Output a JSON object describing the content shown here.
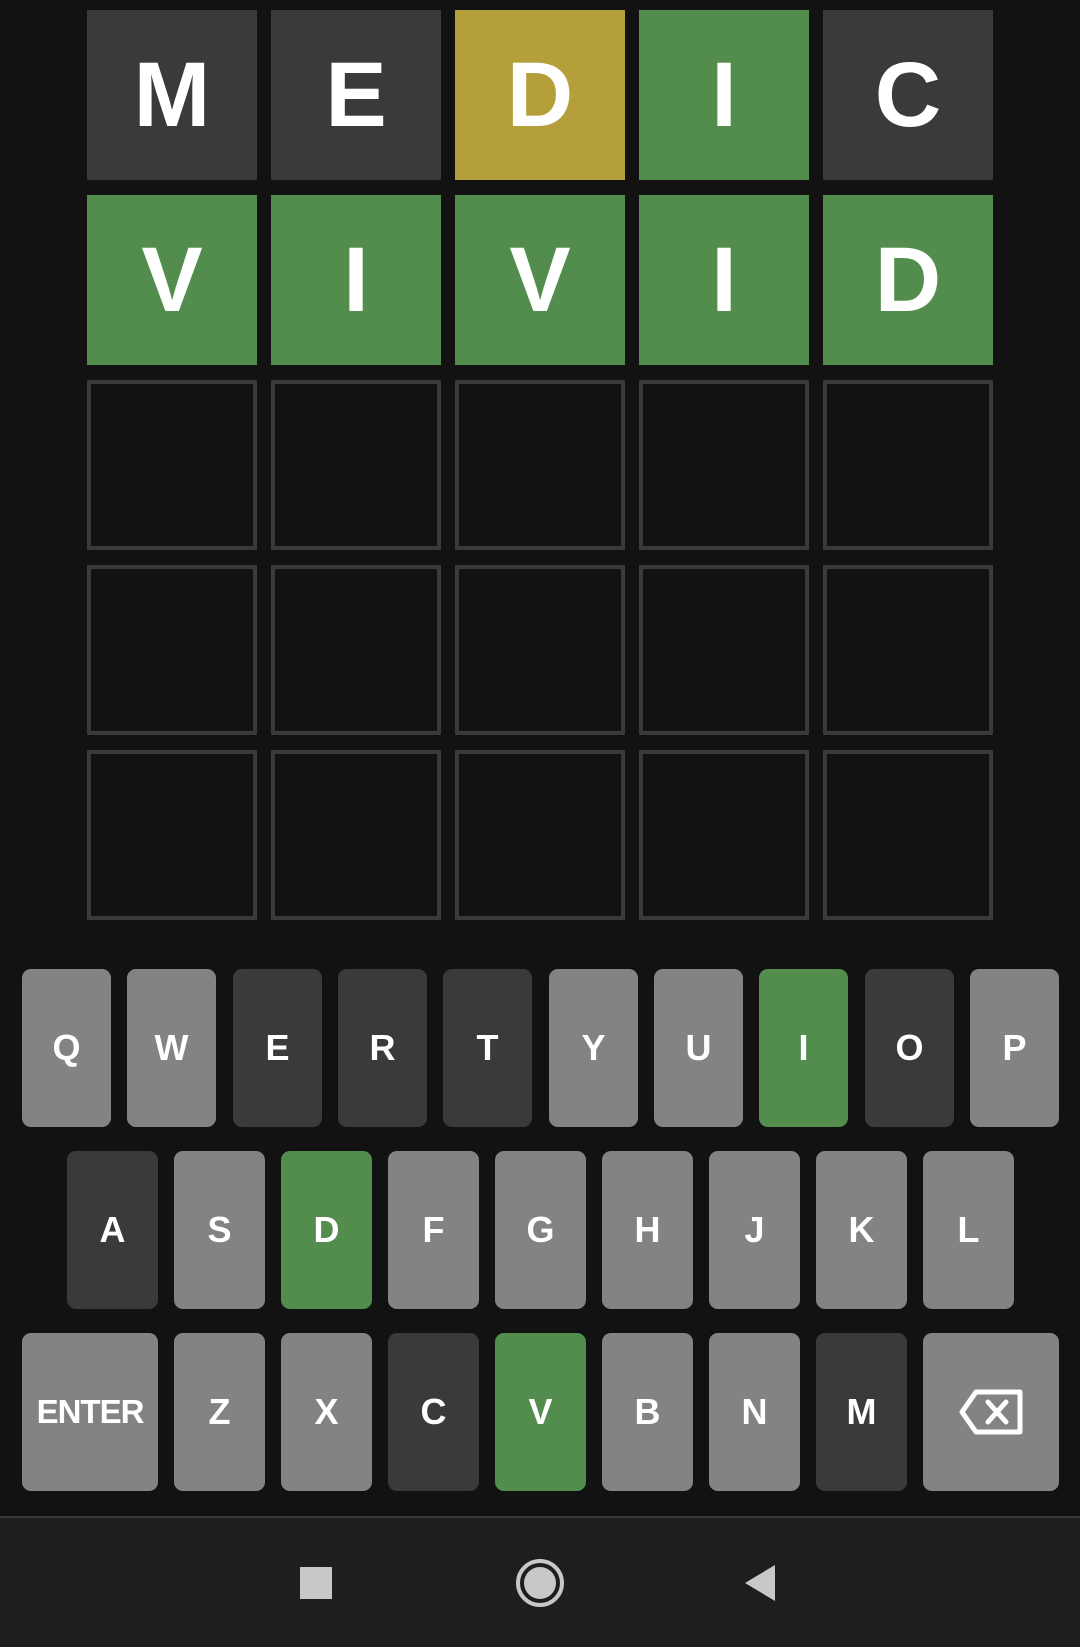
{
  "board": {
    "rows": [
      [
        {
          "letter": "M",
          "state": "absent"
        },
        {
          "letter": "E",
          "state": "absent"
        },
        {
          "letter": "D",
          "state": "present"
        },
        {
          "letter": "I",
          "state": "correct"
        },
        {
          "letter": "C",
          "state": "absent"
        }
      ],
      [
        {
          "letter": "V",
          "state": "correct"
        },
        {
          "letter": "I",
          "state": "correct"
        },
        {
          "letter": "V",
          "state": "correct"
        },
        {
          "letter": "I",
          "state": "correct"
        },
        {
          "letter": "D",
          "state": "correct"
        }
      ],
      [
        {
          "letter": "",
          "state": "empty"
        },
        {
          "letter": "",
          "state": "empty"
        },
        {
          "letter": "",
          "state": "empty"
        },
        {
          "letter": "",
          "state": "empty"
        },
        {
          "letter": "",
          "state": "empty"
        }
      ],
      [
        {
          "letter": "",
          "state": "empty"
        },
        {
          "letter": "",
          "state": "empty"
        },
        {
          "letter": "",
          "state": "empty"
        },
        {
          "letter": "",
          "state": "empty"
        },
        {
          "letter": "",
          "state": "empty"
        }
      ],
      [
        {
          "letter": "",
          "state": "empty"
        },
        {
          "letter": "",
          "state": "empty"
        },
        {
          "letter": "",
          "state": "empty"
        },
        {
          "letter": "",
          "state": "empty"
        },
        {
          "letter": "",
          "state": "empty"
        }
      ]
    ]
  },
  "keyboard": {
    "rows": [
      [
        {
          "label": "Q",
          "state": "unused"
        },
        {
          "label": "W",
          "state": "unused"
        },
        {
          "label": "E",
          "state": "absent"
        },
        {
          "label": "R",
          "state": "absent"
        },
        {
          "label": "T",
          "state": "absent"
        },
        {
          "label": "Y",
          "state": "unused"
        },
        {
          "label": "U",
          "state": "unused"
        },
        {
          "label": "I",
          "state": "correct"
        },
        {
          "label": "O",
          "state": "absent"
        },
        {
          "label": "P",
          "state": "unused"
        }
      ],
      [
        {
          "label": "A",
          "state": "absent"
        },
        {
          "label": "S",
          "state": "unused"
        },
        {
          "label": "D",
          "state": "correct"
        },
        {
          "label": "F",
          "state": "unused"
        },
        {
          "label": "G",
          "state": "unused"
        },
        {
          "label": "H",
          "state": "unused"
        },
        {
          "label": "J",
          "state": "unused"
        },
        {
          "label": "K",
          "state": "unused"
        },
        {
          "label": "L",
          "state": "unused"
        }
      ],
      [
        {
          "label": "ENTER",
          "state": "unused",
          "kind": "enter"
        },
        {
          "label": "Z",
          "state": "unused"
        },
        {
          "label": "X",
          "state": "unused"
        },
        {
          "label": "C",
          "state": "absent"
        },
        {
          "label": "V",
          "state": "correct"
        },
        {
          "label": "B",
          "state": "unused"
        },
        {
          "label": "N",
          "state": "unused"
        },
        {
          "label": "M",
          "state": "absent"
        },
        {
          "label": "",
          "state": "unused",
          "kind": "backspace",
          "icon": "backspace-icon"
        }
      ]
    ]
  },
  "navbar": {
    "buttons": [
      {
        "name": "recents-button",
        "icon": "square-icon"
      },
      {
        "name": "home-button",
        "icon": "circle-icon"
      },
      {
        "name": "back-button",
        "icon": "triangle-back-icon"
      }
    ]
  },
  "colors": {
    "background": "#121213",
    "absent": "#3a3a3c",
    "present": "#b59f3b",
    "correct": "#538d4e",
    "unused_key": "#818384"
  }
}
